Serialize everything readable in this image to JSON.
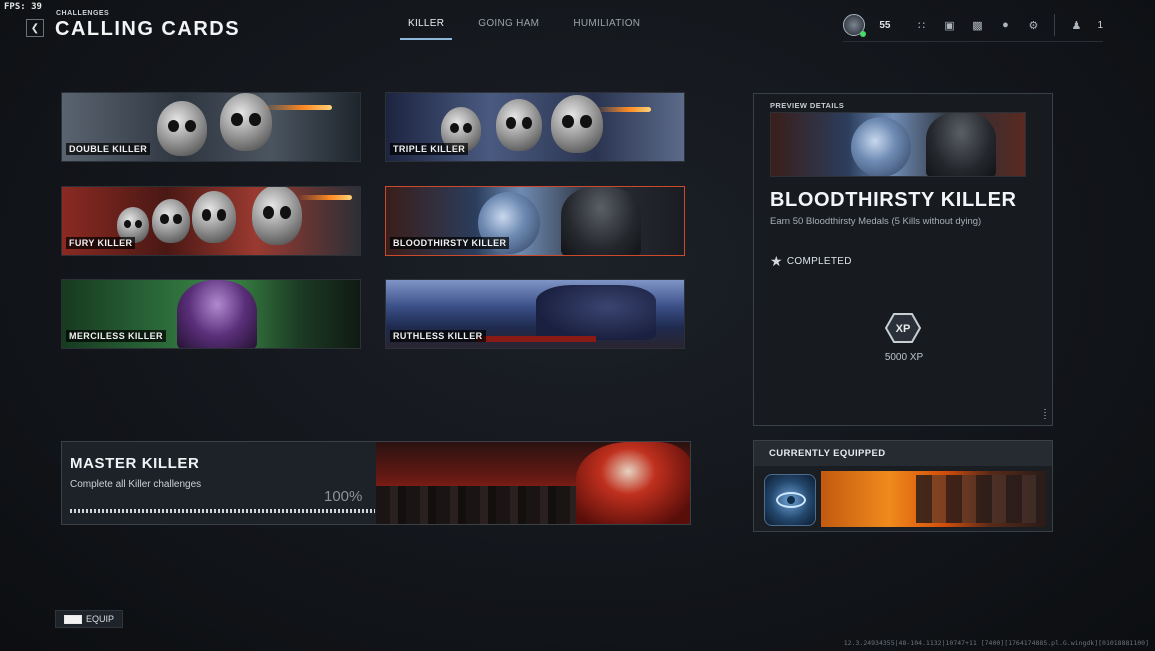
{
  "fps": "FPS:  39",
  "header": {
    "breadcrumb": "CHALLENGES",
    "title": "CALLING CARDS",
    "back_icon": "chevron-left-icon"
  },
  "tabs": [
    {
      "label": "KILLER",
      "active": true
    },
    {
      "label": "GOING HAM",
      "active": false
    },
    {
      "label": "HUMILIATION",
      "active": false
    }
  ],
  "topbar": {
    "rank_level": "55",
    "party_count": "1",
    "icons": [
      "grid-menu-icon",
      "store-icon",
      "camera-icon",
      "bell-icon",
      "gear-icon",
      "party-icon"
    ]
  },
  "cards": [
    {
      "label": "DOUBLE KILLER",
      "theme": "#3c4550"
    },
    {
      "label": "TRIPLE KILLER",
      "theme": "#2a3555"
    },
    {
      "label": "FURY KILLER",
      "theme": "#7a2520"
    },
    {
      "label": "BLOODTHIRSTY KILLER",
      "theme": "#2b3d5c",
      "selected": true
    },
    {
      "label": "MERCILESS KILLER",
      "theme": "#2c6b3a"
    },
    {
      "label": "RUTHLESS KILLER",
      "theme": "#3a4e86"
    }
  ],
  "master": {
    "title": "MASTER KILLER",
    "description": "Complete all Killer challenges",
    "progress_text": "100%",
    "progress": 1.0
  },
  "preview": {
    "header": "PREVIEW DETAILS",
    "title": "BLOODTHIRSTY KILLER",
    "description": "Earn 50 Bloodthirsty Medals (5 Kills without dying)",
    "status": "COMPLETED",
    "xp_badge": "XP",
    "xp_amount": "5000 XP"
  },
  "equipped": {
    "header": "CURRENTLY EQUIPPED"
  },
  "footer": {
    "equip_label": "EQUIP",
    "build_info": "12.3.24934355|48-104.1132|10747+11 [7400][1764174885.pl.G.wingdk][01018881100]"
  },
  "colors": {
    "accent": "#8fb7d9",
    "selected_border": "#c94b2b",
    "online": "#48d86a"
  }
}
